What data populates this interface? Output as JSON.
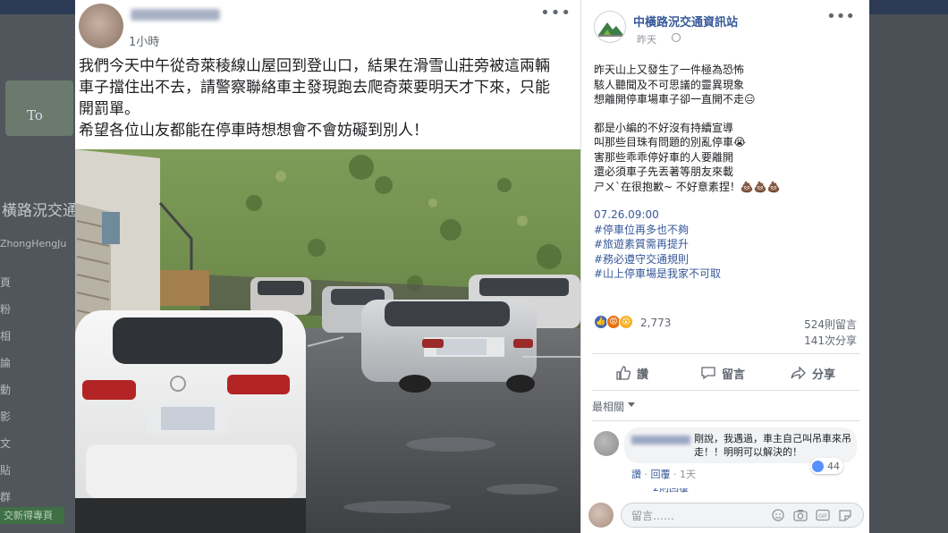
{
  "background": {
    "logo_text": "To",
    "page_name": "橫路況交通",
    "page_handle": "ZhongHengJu",
    "nav_items": [
      "頁",
      "粉",
      "相",
      "論",
      "動",
      "影",
      "文",
      "貼",
      "群"
    ],
    "button_label": "交新得專頁"
  },
  "left_post": {
    "time": "1小時",
    "body_lines": [
      "我們今天中午從奇萊稜線山屋回到登山口，結果在滑雪山莊旁被這兩輛",
      "車子擋住出不去，請警察聯絡車主發現跑去爬奇萊要明天才下來，只能",
      "開罰單。",
      "希望各位山友都能在停車時想想會不會妨礙到別人！"
    ]
  },
  "right_post": {
    "page_name": "中橫路況交通資訊站",
    "time": "昨天",
    "body": [
      "昨天山上又發生了一件極為恐怖",
      "駭人聽聞及不可思議的靈異現象",
      "想離開停車場車子卻一直開不走😑",
      "",
      "都是小編的不好沒有持續宣導",
      "叫那些目珠有問題的別亂停車😭",
      "害那些乖乖停好車的人要離開",
      "還必須車子先丟著等朋友來載",
      "ㄕㄨˋ在很抱歉~ 不好意素捏！💩💩💩",
      ""
    ],
    "date_line": "07.26.09:00",
    "hashtags": [
      "#停車位再多也不夠",
      "#旅遊素質需再提升",
      "#務必遵守交通規則",
      "#山上停車場是我家不可取"
    ],
    "reaction_count": "2,773",
    "comment_count": "524則留言",
    "share_count": "141次分享",
    "actions": {
      "like": "讚",
      "comment": "留言",
      "share": "分享"
    },
    "sort_label": "最相關",
    "comment": {
      "text": "剛說，我遇過，車主自己叫吊車來吊走！！明明可以解決的！",
      "likes": "44",
      "like_action": "讚",
      "reply_action": "回覆",
      "time": "1天"
    },
    "more_replies": "2則回覆",
    "comment_placeholder": "留言……"
  },
  "colors": {
    "link_blue": "#365899",
    "facebook_blue": "#4267b2",
    "text_dark": "#1c1e21",
    "text_gray": "#606770"
  }
}
